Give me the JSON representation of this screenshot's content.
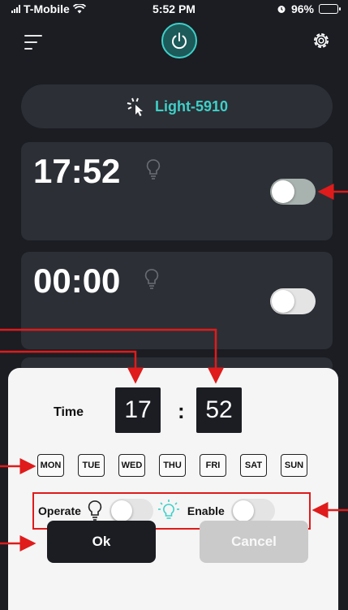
{
  "status_bar": {
    "carrier": "T-Mobile",
    "time": "5:52 PM",
    "battery": "96%"
  },
  "device": {
    "name": "Light-5910"
  },
  "schedules": [
    {
      "time": "17:52",
      "enabled": false
    },
    {
      "time": "00:00",
      "enabled": false
    }
  ],
  "dialog": {
    "time_label": "Time",
    "hour": "17",
    "separator": ":",
    "minute": "52",
    "days": [
      "MON",
      "TUE",
      "WED",
      "THU",
      "FRI",
      "SAT",
      "SUN"
    ],
    "operate_label": "Operate",
    "enable_label": "Enable",
    "ok_label": "Ok",
    "cancel_label": "Cancel"
  },
  "colors": {
    "accent": "#3ed0c8",
    "background": "#1b1d23",
    "card": "#2c2f36",
    "annotation": "#e01b1b"
  },
  "icons": [
    "menu-icon",
    "power-icon",
    "gear-icon",
    "cursor-click-icon",
    "bulb-icon",
    "bulb-lit-icon"
  ]
}
